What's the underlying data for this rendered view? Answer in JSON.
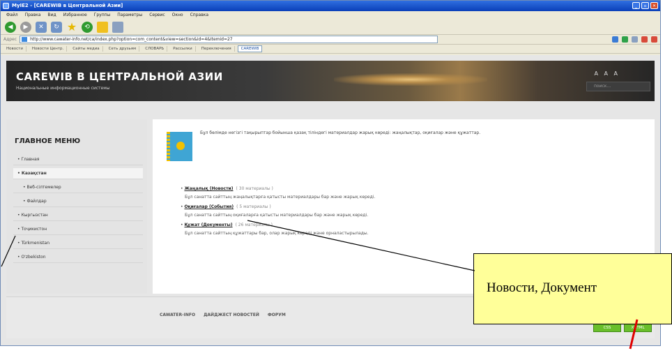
{
  "window": {
    "title": "MyIE2 - [CAREWIB в Центральной Азии]",
    "controls": [
      "_",
      "▫",
      "✕"
    ]
  },
  "menubar": [
    "Файл",
    "Правка",
    "Вид",
    "Избранное",
    "Группы",
    "Параметры",
    "Сервис",
    "Окно",
    "Справка"
  ],
  "address": {
    "label": "Адрес",
    "url": "http://www.cawater-info.net/ca/index.php?option=com_content&view=section&id=4&Itemid=27"
  },
  "links": [
    "Новости",
    "Новости Центр.",
    "Сайты медиа",
    "Сеть друзьям",
    "СЛОВАРЬ",
    "Рассылки",
    "Переключения",
    "CAREWIB"
  ],
  "page": {
    "site_title": "CAREWIB В ЦЕНТРАЛЬНОЙ АЗИИ",
    "site_subtitle": "Национальные информационные системы",
    "font_controls": "A A A",
    "search_placeholder": "поиск...",
    "sidebar": {
      "heading": "ГЛАВНОЕ МЕНЮ",
      "items": [
        {
          "label": "• Главная",
          "active": false,
          "sub": false
        },
        {
          "label": "• Казақстан",
          "active": true,
          "sub": false
        },
        {
          "label": "• Веб-сілтемелер",
          "active": false,
          "sub": true
        },
        {
          "label": "• Файлдар",
          "active": false,
          "sub": true
        },
        {
          "label": "• Кыргызстан",
          "active": false,
          "sub": false
        },
        {
          "label": "• Тоҷикистон",
          "active": false,
          "sub": false
        },
        {
          "label": "• Türkmenistan",
          "active": false,
          "sub": false
        },
        {
          "label": "• O'zbekiston",
          "active": false,
          "sub": false
        }
      ]
    },
    "content": {
      "intro": "Бұл бөлімде негізгі тақырыптар бойынша қазақ тіліндегі материалдар жарық көреді: жаңалықтар, оқиғалар және құжаттар.",
      "entries": [
        {
          "title": "Жаңалық (Новости)",
          "count": "( 30 материалы )",
          "desc": "Бұл санатта сайттың жаңалықтарға қатысты материалдары бар және жарық көреді."
        },
        {
          "title": "Оқиғалар (События)",
          "count": "( 5 материалы )",
          "desc": "Бұл санатта сайттың оқиғаларға қатысты материалдары бар және жарық көреді."
        },
        {
          "title": "Құжат (Документы)",
          "count": "( 26 материалы )",
          "desc": "Бұл санатта сайттың құжаттары бар, олар жарық көреді және орналастырылады."
        }
      ]
    },
    "footer": {
      "links": [
        "CAWATER-INFO",
        "ДАЙДЖЕСТ НОВОСТЕЙ",
        "ФОРУМ"
      ],
      "badges": [
        "CSS",
        "XHTML"
      ]
    }
  },
  "annotation": {
    "callout_text": "Новости, Документ"
  },
  "colors": {
    "callout_fill": "#ffff99",
    "arrow_red": "#e00000",
    "titlebar": "#0a3fb8"
  }
}
